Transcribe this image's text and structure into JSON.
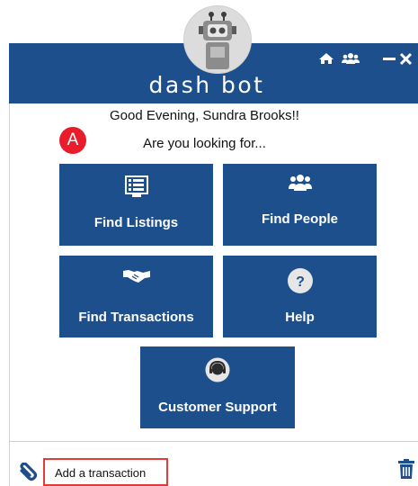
{
  "header": {
    "title": "dash bot",
    "icons": [
      "home-icon",
      "group-icon",
      "minimize-icon",
      "close-icon"
    ],
    "color": "#1d4f8d"
  },
  "greeting": "Good Evening, Sundra Brooks!!",
  "question": "Are you looking for...",
  "annotation_badge": "A",
  "tiles": [
    {
      "label": "Find Listings",
      "icon": "listing-icon"
    },
    {
      "label": "Find People",
      "icon": "people-icon"
    },
    {
      "label": "Find Transactions",
      "icon": "handshake-icon"
    },
    {
      "label": "Help",
      "icon": "help-icon"
    },
    {
      "label": "Customer Support",
      "icon": "headset-icon"
    }
  ],
  "input": {
    "value": "Add a transaction"
  },
  "colors": {
    "tile": "#1d4f8d",
    "highlight": "#e23b3b",
    "badge": "#e81c2b"
  }
}
